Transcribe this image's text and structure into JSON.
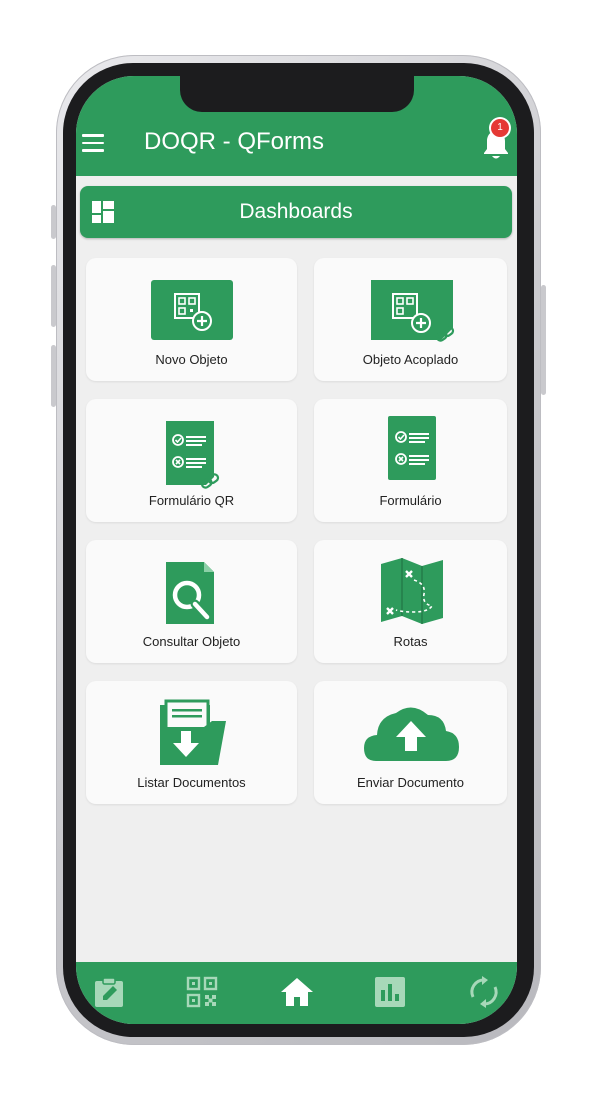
{
  "app": {
    "title": "DOQR - QForms",
    "notification_count": "1"
  },
  "dashboard": {
    "label": "Dashboards"
  },
  "cards": [
    {
      "label": "Novo Objeto",
      "icon": "new-object-icon"
    },
    {
      "label": "Objeto Acoplado",
      "icon": "coupled-object-icon"
    },
    {
      "label": "Formulário QR",
      "icon": "qr-form-icon"
    },
    {
      "label": "Formulário",
      "icon": "form-icon"
    },
    {
      "label": "Consultar Objeto",
      "icon": "search-object-icon"
    },
    {
      "label": "Rotas",
      "icon": "map-route-icon"
    },
    {
      "label": "Listar Documentos",
      "icon": "document-download-icon"
    },
    {
      "label": "Enviar Documento",
      "icon": "cloud-upload-icon"
    }
  ],
  "bottom_nav": [
    {
      "icon": "clipboard-edit-icon"
    },
    {
      "icon": "qr-code-icon"
    },
    {
      "icon": "home-icon",
      "active": true
    },
    {
      "icon": "bar-chart-icon"
    },
    {
      "icon": "sync-icon"
    }
  ],
  "colors": {
    "primary": "#2e9b5c",
    "badge": "#e53935",
    "background": "#efefef",
    "card": "#fafafa"
  }
}
